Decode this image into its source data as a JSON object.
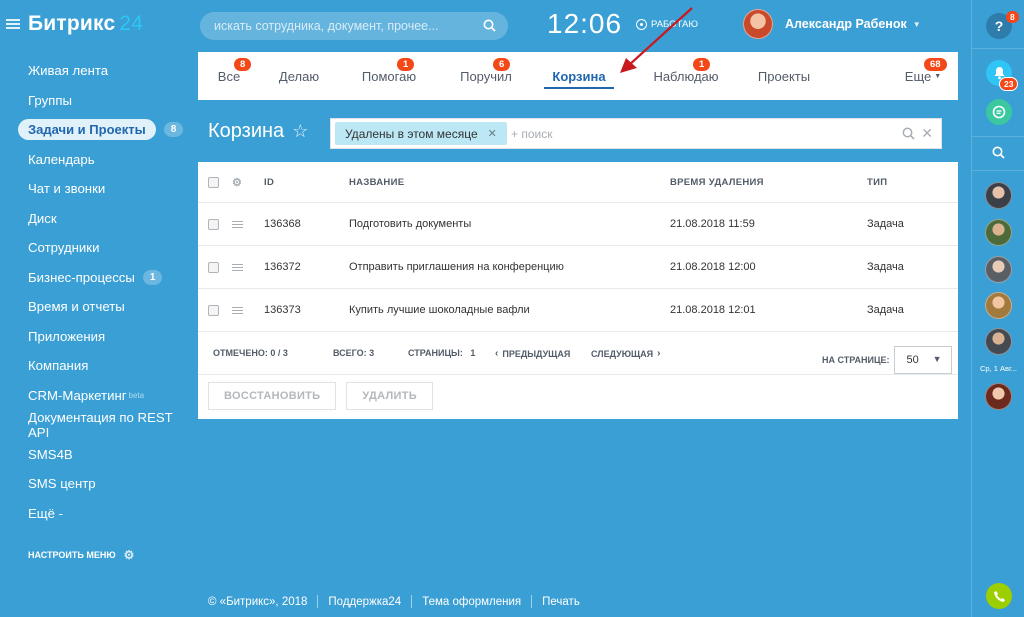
{
  "app": {
    "logo_text": "Битрикс",
    "logo_num": "24"
  },
  "header": {
    "search_placeholder": "искать сотрудника, документ, прочее...",
    "clock": "12:06",
    "work_status": "РАБОТАЮ",
    "user_name": "Александр Рабенок"
  },
  "sidebar": {
    "items": [
      {
        "label": "Живая лента"
      },
      {
        "label": "Группы"
      },
      {
        "label": "Задачи и Проекты",
        "badge": "8"
      },
      {
        "label": "Календарь"
      },
      {
        "label": "Чат и звонки"
      },
      {
        "label": "Диск"
      },
      {
        "label": "Сотрудники"
      },
      {
        "label": "Бизнес-процессы",
        "badge": "1"
      },
      {
        "label": "Время и отчеты"
      },
      {
        "label": "Приложения"
      },
      {
        "label": "Компания"
      },
      {
        "label": "CRM-Маркетинг",
        "sup": "beta"
      },
      {
        "label": "Документация по REST API"
      },
      {
        "label": "SMS4B"
      },
      {
        "label": "SMS центр"
      },
      {
        "label": "Ещё -"
      }
    ],
    "settings_label": "НАСТРОИТЬ МЕНЮ"
  },
  "tabs": [
    {
      "label": "Все",
      "badge": "8"
    },
    {
      "label": "Делаю"
    },
    {
      "label": "Помогаю",
      "badge": "1"
    },
    {
      "label": "Поручил",
      "badge": "6"
    },
    {
      "label": "Корзина"
    },
    {
      "label": "Наблюдаю",
      "badge": "1"
    },
    {
      "label": "Проекты"
    },
    {
      "label": "Еще",
      "badge": "68"
    }
  ],
  "page": {
    "title": "Корзина",
    "filter_chip": "Удалены в этом месяце",
    "filter_add": "+ поиск"
  },
  "grid": {
    "columns": {
      "id": "ID",
      "name": "НАЗВАНИЕ",
      "time": "ВРЕМЯ УДАЛЕНИЯ",
      "type": "ТИП"
    },
    "rows": [
      {
        "id": "136368",
        "name": "Подготовить документы",
        "time": "21.08.2018 11:59",
        "type": "Задача"
      },
      {
        "id": "136372",
        "name": "Отправить приглашения на конференцию",
        "time": "21.08.2018 12:00",
        "type": "Задача"
      },
      {
        "id": "136373",
        "name": "Купить лучшие шоколадные вафли",
        "time": "21.08.2018 12:01",
        "type": "Задача"
      }
    ],
    "footer": {
      "selected_label": "ОТМЕЧЕНО:",
      "selected_value": "0 / 3",
      "total_label": "ВСЕГО:",
      "total_value": "3",
      "pages_label": "СТРАНИЦЫ:",
      "pages_value": "1",
      "prev": "ПРЕДЫДУЩАЯ",
      "next": "СЛЕДУЮЩАЯ",
      "per_page_label": "НА СТРАНИЦЕ:",
      "per_page_value": "50"
    },
    "actions": {
      "restore": "ВОССТАНОВИТЬ",
      "delete": "УДАЛИТЬ"
    }
  },
  "footer": {
    "copyright": "© «Битрикс», 2018",
    "support": "Поддержка24",
    "theme": "Тема оформления",
    "print": "Печать"
  },
  "right_panel": {
    "help_badge": "8",
    "notif_badge": "23",
    "date_label": "Ср, 1 Авг..."
  },
  "colors": {
    "background": "#3a9fd4",
    "accent": "#2067b0",
    "badge": "#f54819",
    "chip": "#bce8f5",
    "phone": "#9dcf00"
  }
}
